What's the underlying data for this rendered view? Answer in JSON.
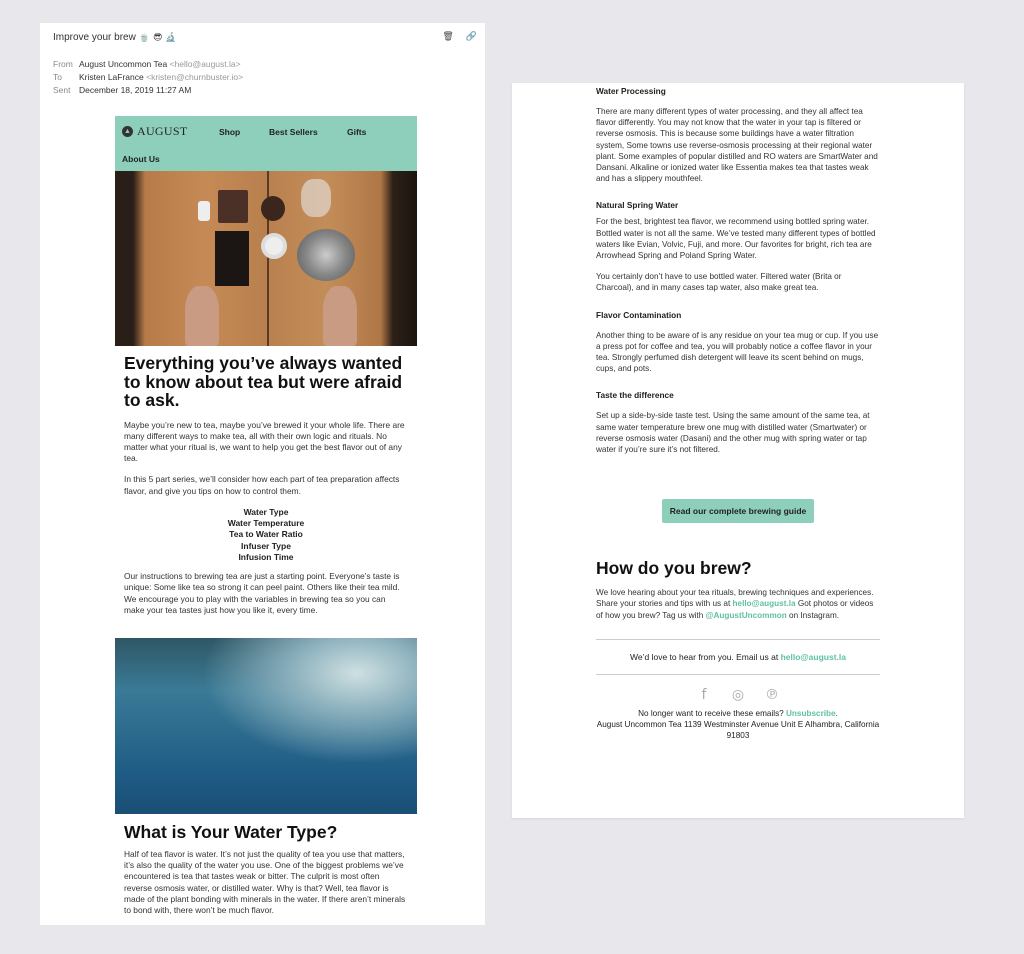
{
  "email": {
    "subject": "Improve your brew",
    "subject_emojis": [
      "🍵",
      "😎",
      "🔬"
    ],
    "actions": {
      "delete_icon": "trash-icon",
      "link_icon": "link-icon"
    },
    "from_label": "From",
    "from_name": "August Uncommon Tea",
    "from_address": "<hello@august.la>",
    "to_label": "To",
    "to_name": "Kristen LaFrance",
    "to_address": "<kristen@churnbuster.io>",
    "sent_label": "Sent",
    "sent_value": "December 18, 2019 11:27 AM"
  },
  "nav": {
    "brand": "AUGUST",
    "items": [
      "Shop",
      "Best Sellers",
      "Gifts",
      "About Us"
    ]
  },
  "colors": {
    "accent": "#8ecfbc",
    "link": "#5fc0a5",
    "background": "#e8e7ec"
  },
  "intro": {
    "headline": "Everything you’ve always wanted to know about tea but were afraid to ask.",
    "p1": "Maybe you’re new to tea, maybe you’ve brewed it your whole life. There are many different ways to make tea, all with their own logic and rituals. No matter what your ritual is, we want to help you get the best flavor out of any tea.",
    "p2": "In this 5 part series, we’ll consider how each part of tea preparation affects flavor, and give you tips on how to control them.",
    "topics": [
      "Water Type",
      "Water Temperature",
      "Tea to Water Ratio",
      "Infuser Type",
      "Infusion Time"
    ],
    "p3": "Our instructions to brewing tea are just a starting point. Everyone’s taste is unique: Some like tea so strong it can peel paint. Others like their tea mild. We encourage you to play with the variables in brewing tea so you can make your tea tastes just how you like it, every time."
  },
  "water_type": {
    "title": "What is Your Water Type?",
    "p1": "Half of tea flavor is water. It’s not just the quality of tea you use that matters, it’s also the quality of the water you use. One of the biggest problems  we’ve encountered is tea that tastes weak or bitter. The culprit is most often reverse osmosis water, or distilled water. Why is that? Well, tea flavor is made of the plant bonding with minerals in the water. If there aren’t minerals to bond with, there won’t be much flavor."
  },
  "sections": [
    {
      "heading": "Water Processing",
      "paragraphs": [
        "There are many different types of water processing, and they all affect tea flavor differently. You may not know that the water in your tap is filtered or reverse osmosis. This is because some buildings have a water filtration system, Some towns use reverse-osmosis processing at their regional water plant. Some examples of popular distilled and RO waters are SmartWater and Dansani. Alkaline or ionized water like Essentia makes tea that tastes weak and has a slippery mouthfeel."
      ]
    },
    {
      "heading": "Natural Spring Water",
      "paragraphs": [
        "For the best, brightest tea flavor, we recommend using bottled spring water. Bottled water is not all the same. We’ve tested many different types of bottled waters like Evian, Volvic, Fuji, and more. Our favorites for bright, rich tea are Arrowhead Spring and Poland Spring Water.",
        "You certainly don’t have to use bottled water. Filtered water (Brita or Charcoal), and in many cases tap water, also make great tea."
      ]
    },
    {
      "heading": "Flavor Contamination",
      "paragraphs": [
        "Another thing to be aware of is any residue on your tea mug or cup. If you use a press pot for coffee and tea, you will probably notice a coffee flavor in your tea. Strongly perfumed dish detergent will leave its scent behind on mugs, cups, and pots."
      ]
    },
    {
      "heading": "Taste the difference",
      "paragraphs": [
        "Set up a side-by-side taste test. Using the same amount of the same tea, at same water temperature brew one mug with distilled water (Smartwater) or reverse osmosis water (Dasani) and the other mug with spring water or tap water if you’re sure it’s not filtered."
      ]
    }
  ],
  "cta": {
    "label": "Read our complete brewing guide"
  },
  "brew": {
    "title": "How do you brew?",
    "text1": "We love hearing about your tea rituals, brewing techniques and experiences. Share your stories and tips with us at ",
    "email_link": "hello@august.la",
    "text2": " Got photos or videos of how you brew? Tag us with ",
    "instagram_link": "@AugustUncommon",
    "text3": " on Instagram."
  },
  "footer": {
    "love_text": "We’d love to hear from you. Email us at ",
    "love_link": "hello@august.la",
    "social": [
      {
        "name": "facebook-icon",
        "glyph": "f"
      },
      {
        "name": "instagram-icon",
        "glyph": "◎"
      },
      {
        "name": "pinterest-icon",
        "glyph": "℗"
      }
    ],
    "unsub_text": "No longer want to receive these emails? ",
    "unsub_link": "Unsubscribe",
    "unsub_after": ".",
    "address": "August Uncommon Tea 1139 Westminster Avenue Unit E Alhambra, California 91803"
  }
}
